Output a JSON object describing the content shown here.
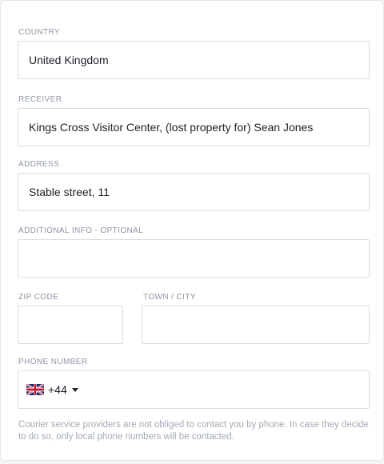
{
  "form": {
    "country": {
      "label": "COUNTRY",
      "value": "United Kingdom"
    },
    "receiver": {
      "label": "RECEIVER",
      "value": "Kings Cross Visitor Center, (lost property for) Sean Jones"
    },
    "address": {
      "label": "ADDRESS",
      "value": "Stable street, 11"
    },
    "additional_info": {
      "label": "ADDITIONAL INFO - OPTIONAL",
      "value": ""
    },
    "zip_code": {
      "label": "ZIP CODE",
      "value": ""
    },
    "town_city": {
      "label": "TOWN / CITY",
      "value": ""
    },
    "phone": {
      "label": "PHONE NUMBER",
      "country_code": "+44",
      "flag_icon": "uk-flag-icon",
      "number": ""
    },
    "note": "Courier service providers are not obliged to contact you by phone. In case they decide to do so, only local phone numbers will be contacted."
  }
}
